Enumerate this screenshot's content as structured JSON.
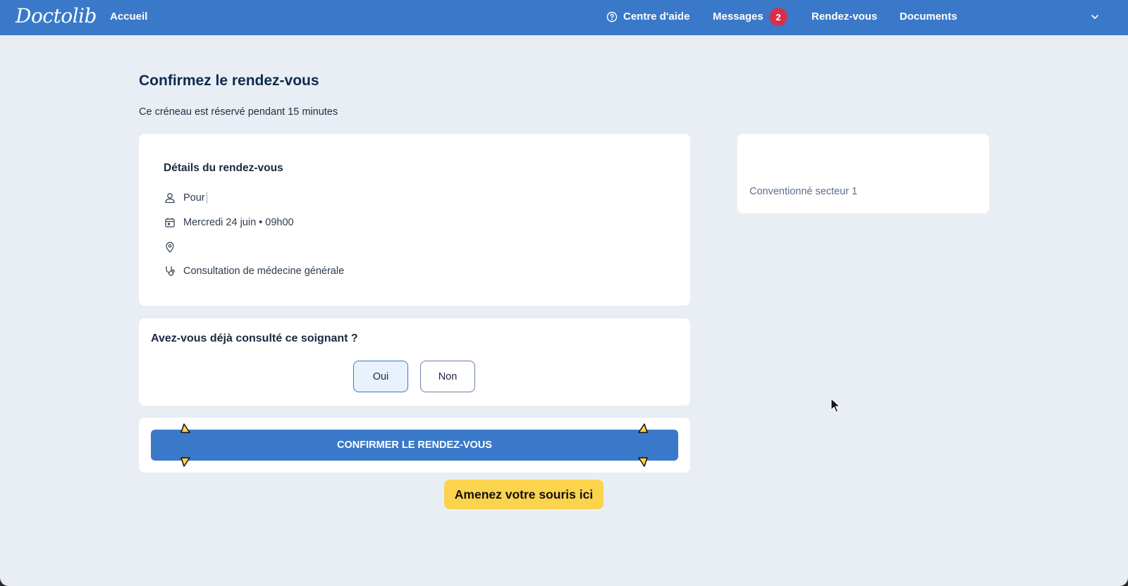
{
  "header": {
    "logo": "Doctolib",
    "nav": {
      "home": "Accueil",
      "help": "Centre d'aide",
      "messages": "Messages",
      "messages_count": "2",
      "appointments": "Rendez-vous",
      "documents": "Documents"
    },
    "icons": {
      "help": "help-circle-icon",
      "menu": "chevron-down-icon"
    }
  },
  "page": {
    "title": "Confirmez le rendez-vous",
    "subtitle": "Ce créneau est réservé pendant 15 minutes"
  },
  "details": {
    "title": "Détails du rendez-vous",
    "for_label": "Pour",
    "date": "Mercredi 24 juin • 09h00",
    "location": "",
    "reason": "Consultation de médecine générale",
    "icons": [
      "user-icon",
      "calendar-icon",
      "location-pin-icon",
      "stethoscope-icon"
    ]
  },
  "question": {
    "title": "Avez-vous déjà consulté ce soignant ?",
    "yes": "Oui",
    "no": "Non",
    "selected": "Oui"
  },
  "confirm": {
    "label": "CONFIRMER LE RENDEZ-VOUS"
  },
  "side_card": {
    "convention": "Conventionné secteur 1"
  },
  "hint": {
    "label": "Amenez votre souris ici"
  },
  "colors": {
    "primary": "#3a79c9",
    "background": "#e9eef4",
    "badge": "#d6304f",
    "highlight": "#fcd34d",
    "title": "#0d2b4e"
  }
}
